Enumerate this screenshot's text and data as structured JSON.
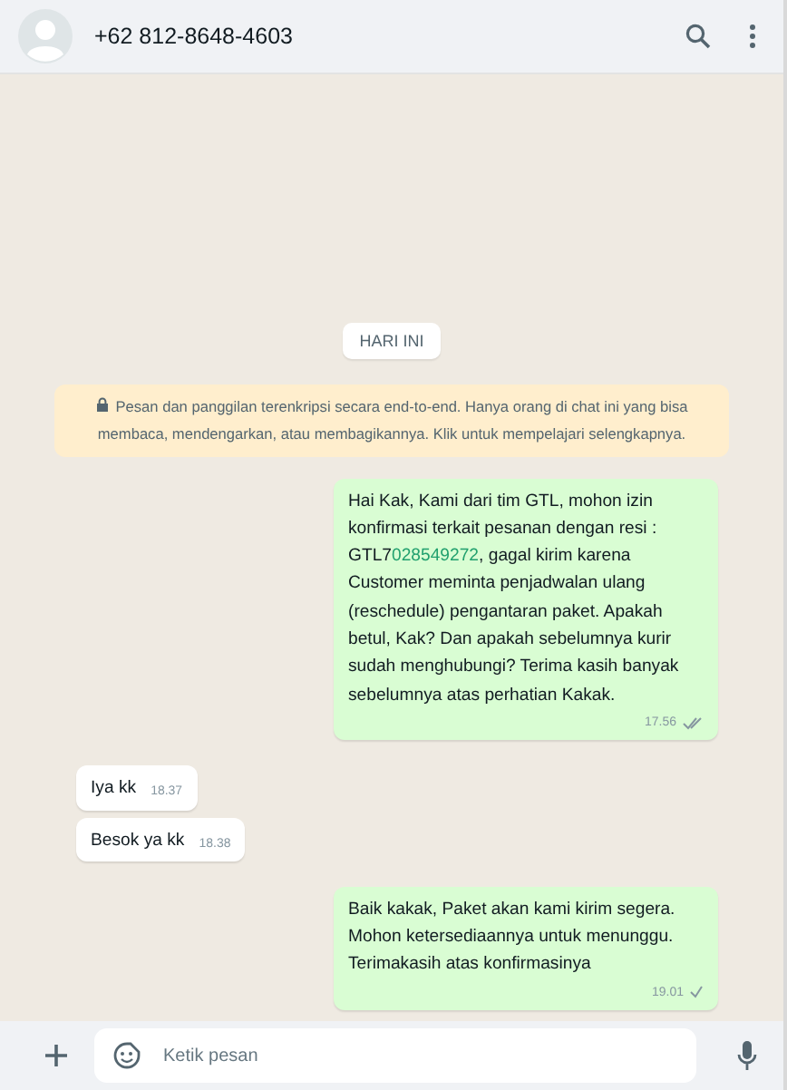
{
  "header": {
    "contact": "+62 812-8648-4603"
  },
  "date_chip": "HARI INI",
  "encryption_notice": "Pesan dan panggilan terenkripsi secara end-to-end. Hanya orang di chat ini yang bisa membaca, mendengarkan, atau membagikannya. Klik untuk mempelajari selengkapnya.",
  "messages": [
    {
      "kind": "outgoing",
      "parts": [
        {
          "kind": "text",
          "text": "Hai Kak, Kami dari tim GTL, mohon izin konfirmasi terkait pesanan dengan resi : GTL7"
        },
        {
          "kind": "link",
          "text": "028549272"
        },
        {
          "kind": "text",
          "text": ", gagal kirim karena Customer meminta penjadwalan ulang (reschedule) pengantaran paket. Apakah betul, Kak? Dan apakah sebelumnya kurir sudah menghubungi? Terima kasih banyak sebelumnya atas perhatian Kakak."
        }
      ],
      "time": "17.56",
      "delivered": true
    },
    {
      "kind": "incoming",
      "parts": [
        {
          "kind": "text",
          "text": "Iya kk"
        }
      ],
      "time": "18.37"
    },
    {
      "kind": "incoming",
      "parts": [
        {
          "kind": "text",
          "text": "Besok ya kk"
        }
      ],
      "time": "18.38"
    },
    {
      "kind": "outgoing",
      "parts": [
        {
          "kind": "text",
          "text": "Baik kakak, Paket akan kami kirim segera. Mohon ketersediaannya untuk menunggu. Terimakasih atas konfirmasinya"
        }
      ],
      "time": "19.01",
      "delivered": false
    }
  ],
  "composer": {
    "placeholder": "Ketik pesan"
  }
}
